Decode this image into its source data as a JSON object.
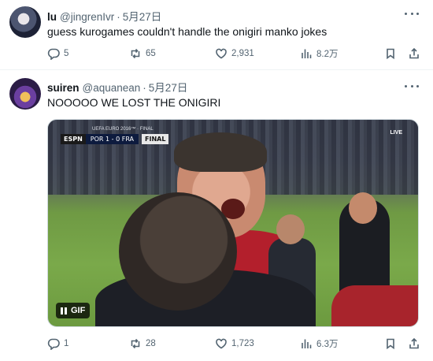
{
  "tweets": [
    {
      "name": "lu",
      "handle": "@jingrenIvr",
      "separator": "·",
      "date": "5月27日",
      "text": "guess kurogames couldn't handle the onigiri manko jokes",
      "stats": {
        "replies": "5",
        "retweets": "65",
        "likes": "2,931",
        "views": "8.2万"
      }
    },
    {
      "name": "suiren",
      "handle": "@aquanean",
      "separator": "·",
      "date": "5月27日",
      "text": "NOOOOO WE LOST THE ONIGIRI",
      "media": {
        "badge": "GIF",
        "scoreboard": {
          "brand": "ESPN",
          "title": "UEFA EURO 2016™ · FINAL",
          "score": "POR 1 - 0 FRA",
          "stage": "FINAL"
        },
        "corner_logo": "LIVE"
      },
      "stats": {
        "replies": "1",
        "retweets": "28",
        "likes": "1,723",
        "views": "6.3万"
      }
    }
  ],
  "icons": [
    "reply-icon",
    "retweet-icon",
    "like-icon",
    "views-icon",
    "bookmark-icon",
    "share-icon",
    "more-icon",
    "pause-icon"
  ],
  "colors": {
    "text": "#0f1419",
    "secondary": "#536471",
    "divider": "#eff3f4"
  }
}
